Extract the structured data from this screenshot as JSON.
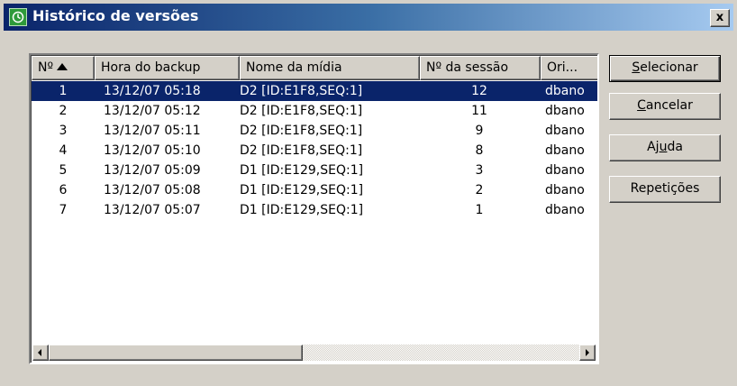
{
  "window": {
    "title": "Histórico de versões",
    "close_label": "x"
  },
  "list": {
    "columns": [
      "Nº",
      "Hora do backup",
      "Nome da mídia",
      "Nº da sessão",
      "Ori..."
    ],
    "sort_column": "Nº",
    "selected_row": 0,
    "rows": [
      {
        "num": "1",
        "hora": "13/12/07 05:18",
        "midia": "D2 [ID:E1F8,SEQ:1]",
        "sessao": "12",
        "ori": "dbano"
      },
      {
        "num": "2",
        "hora": "13/12/07 05:12",
        "midia": "D2 [ID:E1F8,SEQ:1]",
        "sessao": "11",
        "ori": "dbano"
      },
      {
        "num": "3",
        "hora": "13/12/07 05:11",
        "midia": "D2 [ID:E1F8,SEQ:1]",
        "sessao": "9",
        "ori": "dbano"
      },
      {
        "num": "4",
        "hora": "13/12/07 05:10",
        "midia": "D2 [ID:E1F8,SEQ:1]",
        "sessao": "8",
        "ori": "dbano"
      },
      {
        "num": "5",
        "hora": "13/12/07 05:09",
        "midia": "D1 [ID:E129,SEQ:1]",
        "sessao": "3",
        "ori": "dbano"
      },
      {
        "num": "6",
        "hora": "13/12/07 05:08",
        "midia": "D1 [ID:E129,SEQ:1]",
        "sessao": "2",
        "ori": "dbano"
      },
      {
        "num": "7",
        "hora": "13/12/07 05:07",
        "midia": "D1 [ID:E129,SEQ:1]",
        "sessao": "1",
        "ori": "dbano"
      }
    ]
  },
  "buttons": {
    "selecionar": {
      "key": "S",
      "rest": "elecionar"
    },
    "cancelar": {
      "key": "C",
      "rest": "ancelar"
    },
    "ajuda": {
      "pre": "Aj",
      "key": "u",
      "rest": "da"
    },
    "repeticoes": {
      "label": "Repetições"
    }
  },
  "colors": {
    "selection": "#0a246a",
    "title_gradient_start": "#0a246a",
    "title_gradient_end": "#a6caf0"
  },
  "icons": {
    "title": "history-window-icon",
    "sort": "sort-ascending-icon",
    "scroll_left": "scroll-left-arrow-icon",
    "scroll_right": "scroll-right-arrow-icon"
  }
}
